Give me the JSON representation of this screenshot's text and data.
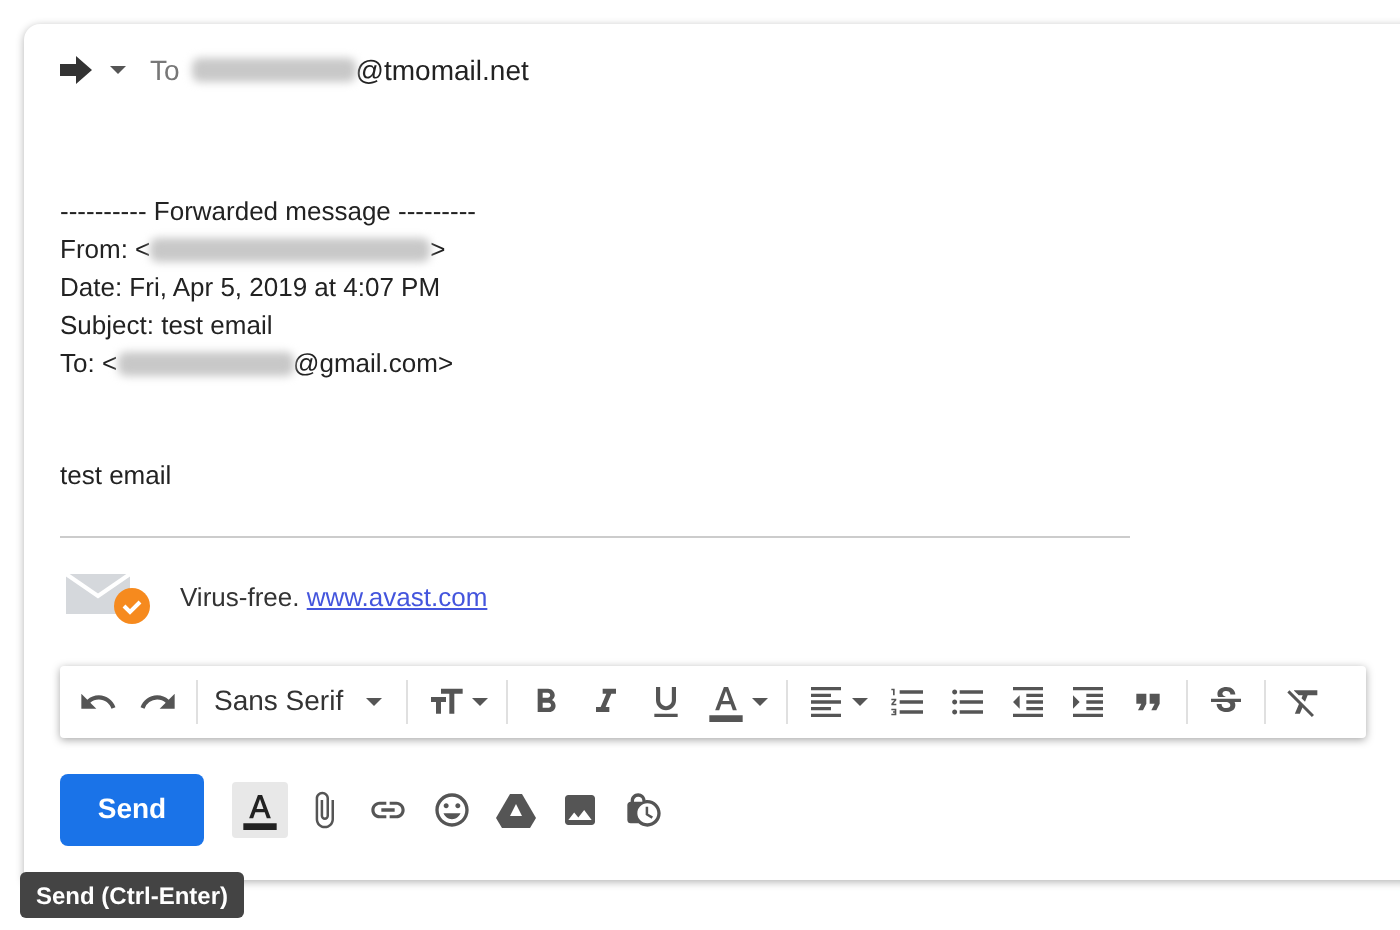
{
  "recipients": {
    "label": "To",
    "address_suffix": "@tmomail.net"
  },
  "forwarded": {
    "header": "---------- Forwarded message ---------",
    "from_prefix": "From: <",
    "from_suffix": ">",
    "date": "Date: Fri, Apr 5, 2019 at 4:07 PM",
    "subject": "Subject: test email",
    "to_prefix": "To: <",
    "to_suffix": "@gmail.com>"
  },
  "body": "test email",
  "signature": {
    "text": "Virus-free.",
    "link": "www.avast.com"
  },
  "toolbar": {
    "font": "Sans Serif",
    "tools": [
      {
        "kind": "undo"
      },
      {
        "kind": "redo"
      },
      {
        "kind": "font"
      },
      {
        "kind": "size"
      },
      {
        "kind": "bold"
      },
      {
        "kind": "italic"
      },
      {
        "kind": "underline"
      },
      {
        "kind": "color"
      },
      {
        "kind": "align"
      },
      {
        "kind": "numbered"
      },
      {
        "kind": "bulleted"
      },
      {
        "kind": "outdent"
      },
      {
        "kind": "indent"
      },
      {
        "kind": "quote"
      },
      {
        "kind": "strike"
      },
      {
        "kind": "clear"
      }
    ]
  },
  "actions": {
    "send": "Send",
    "formatting_selected": true
  },
  "tooltip": "Send (Ctrl-Enter)"
}
